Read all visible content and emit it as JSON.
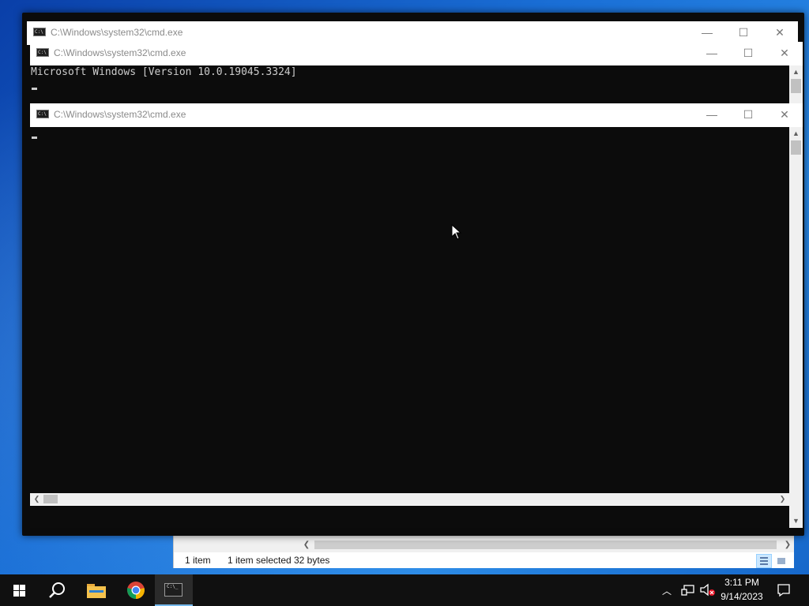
{
  "windows": [
    {
      "title": "C:\\Windows\\system32\\cmd.exe"
    },
    {
      "title": "C:\\Windows\\system32\\cmd.exe",
      "output": "Microsoft Windows [Version 10.0.19045.3324]"
    },
    {
      "title": "C:\\Windows\\system32\\cmd.exe"
    }
  ],
  "controls": {
    "minimize": "—",
    "maximize": "☐",
    "close": "✕"
  },
  "explorer_status": {
    "items": "1 item",
    "selected": "1 item selected",
    "size": "32 bytes"
  },
  "taskbar": {
    "apps": [
      "start-icon",
      "search-icon",
      "file-explorer-icon",
      "chrome-icon",
      "cmd-icon"
    ],
    "time": "3:11 PM",
    "date": "9/14/2023"
  },
  "colors": {
    "console_bg": "#0c0c0c",
    "console_text": "#cccccc",
    "taskbar": "#101010",
    "desktop": "#1a6fd6"
  }
}
